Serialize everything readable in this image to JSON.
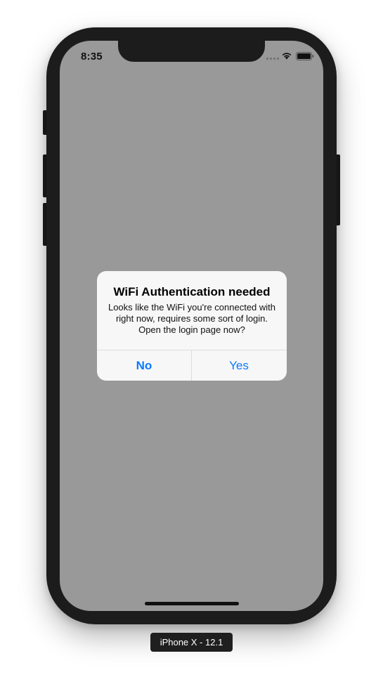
{
  "status_bar": {
    "time": "8:35",
    "icons": [
      "signal-dots-icon",
      "wifi-icon",
      "battery-icon"
    ]
  },
  "alert": {
    "title": "WiFi Authentication needed",
    "message": "Looks like the WiFi you're connected with right now, requires some sort of login. Open the login page now?",
    "buttons": {
      "no_label": "No",
      "yes_label": "Yes"
    }
  },
  "device_label": "iPhone X - 12.1",
  "colors": {
    "screen_background": "#999999",
    "alert_background": "#f7f7f7",
    "button_tint": "#0a7aff",
    "device_frame": "#1c1c1c"
  }
}
